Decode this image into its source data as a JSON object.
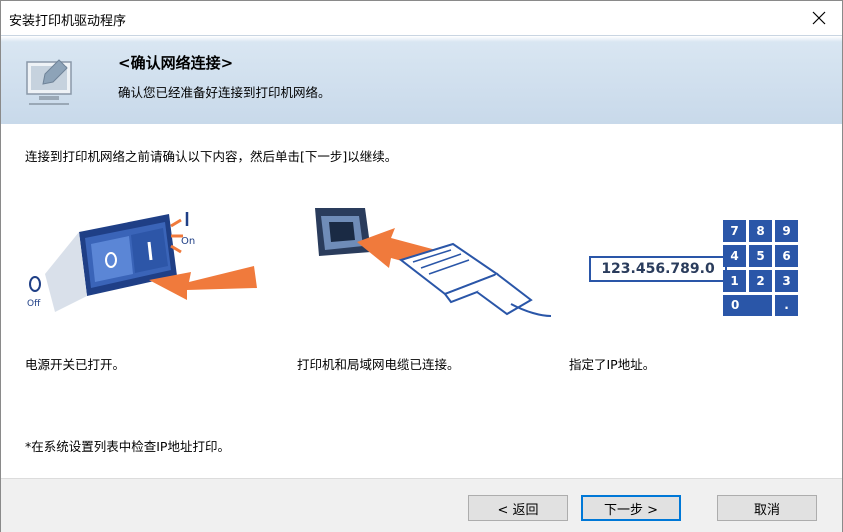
{
  "window": {
    "title": "安装打印机驱动程序"
  },
  "header": {
    "title": "<确认网络连接>",
    "subtitle": "确认您已经准备好连接到打印机网络。"
  },
  "content": {
    "instruction": "连接到打印机网络之前请确认以下内容，然后单击[下一步]以继续。",
    "items": [
      {
        "caption": "电源开关已打开。"
      },
      {
        "caption": "打印机和局域网电缆已连接。"
      },
      {
        "caption": "指定了IP地址。"
      }
    ],
    "switch_labels": {
      "on_text": "On",
      "off_text": "Off"
    },
    "ip_example": "123.456.789.0",
    "keypad": [
      "7",
      "8",
      "9",
      "4",
      "5",
      "6",
      "1",
      "2",
      "3",
      "0",
      "."
    ],
    "footnote": "*在系统设置列表中检查IP地址打印。"
  },
  "buttons": {
    "back": "< 返回",
    "next": "下一步 >",
    "cancel": "取消"
  },
  "colors": {
    "accent": "#0078d7",
    "header_bg": "#c8d9ea",
    "illus_blue": "#2a56a8",
    "illus_orange": "#f07a3c"
  }
}
